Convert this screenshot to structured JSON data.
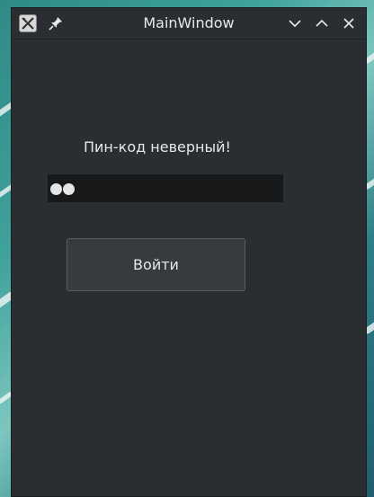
{
  "window": {
    "title": "MainWindow"
  },
  "titlebar": {
    "icons": {
      "app": "app-icon",
      "pin": "pin-icon",
      "minimize": "chevron-down-icon",
      "maximize": "chevron-up-icon",
      "close": "close-icon"
    }
  },
  "form": {
    "message": "Пин-код неверный!",
    "pin_mask_count": 2,
    "login_label": "Войти"
  },
  "colors": {
    "window_bg": "#2a2e32",
    "input_bg": "#16181a",
    "button_bg": "#363b40",
    "text": "#e6e8e9"
  }
}
